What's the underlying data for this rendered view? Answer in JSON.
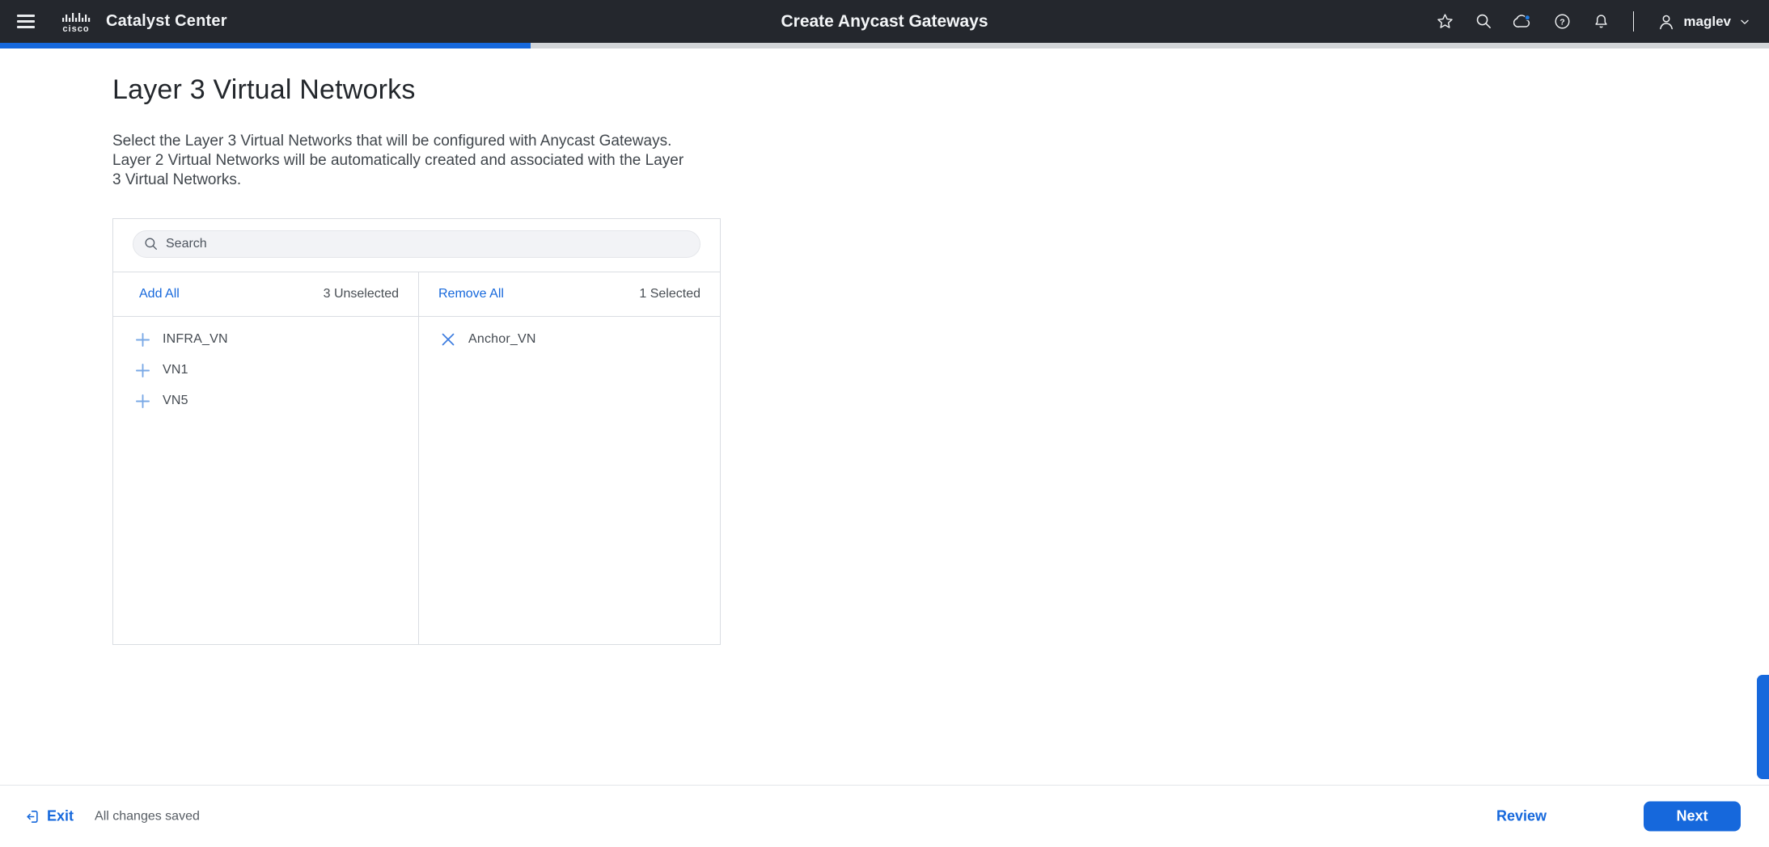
{
  "header": {
    "app_title": "Catalyst Center",
    "page_title": "Create Anycast Gateways",
    "username": "maglev"
  },
  "progress": {
    "percent": 30
  },
  "main": {
    "heading": "Layer 3 Virtual Networks",
    "description_lines": [
      "Select the Layer 3 Virtual Networks that will be configured with Anycast Gateways.",
      "Layer 2 Virtual Networks will be automatically created and associated with the Layer",
      "3 Virtual Networks."
    ]
  },
  "transfer_list": {
    "search_placeholder": "Search",
    "available": {
      "action_label": "Add All",
      "count_label": "3 Unselected",
      "items": [
        "INFRA_VN",
        "VN1",
        "VN5"
      ]
    },
    "selected": {
      "action_label": "Remove All",
      "count_label": "1 Selected",
      "items": [
        "Anchor_VN"
      ]
    }
  },
  "footer": {
    "exit_label": "Exit",
    "autosave_status": "All changes saved",
    "review_label": "Review",
    "next_label": "Next"
  },
  "icons": {
    "header": [
      "menu-icon",
      "cisco-logo",
      "favorites-star-icon",
      "search-icon",
      "cloud-status-icon",
      "help-icon",
      "notifications-bell-icon",
      "user-icon",
      "chevron-down-icon"
    ],
    "list": [
      "add-plus-icon",
      "remove-x-icon"
    ],
    "footer": [
      "exit-door-icon"
    ]
  },
  "colors": {
    "primary_blue": "#1668dc",
    "header_bg": "#24272d",
    "add_icon_blue": "#7aa9e6",
    "remove_icon_blue": "#3c7ce0",
    "progress_track": "#d2d5d8",
    "cloud_badge_blue": "#1f7ae0"
  }
}
